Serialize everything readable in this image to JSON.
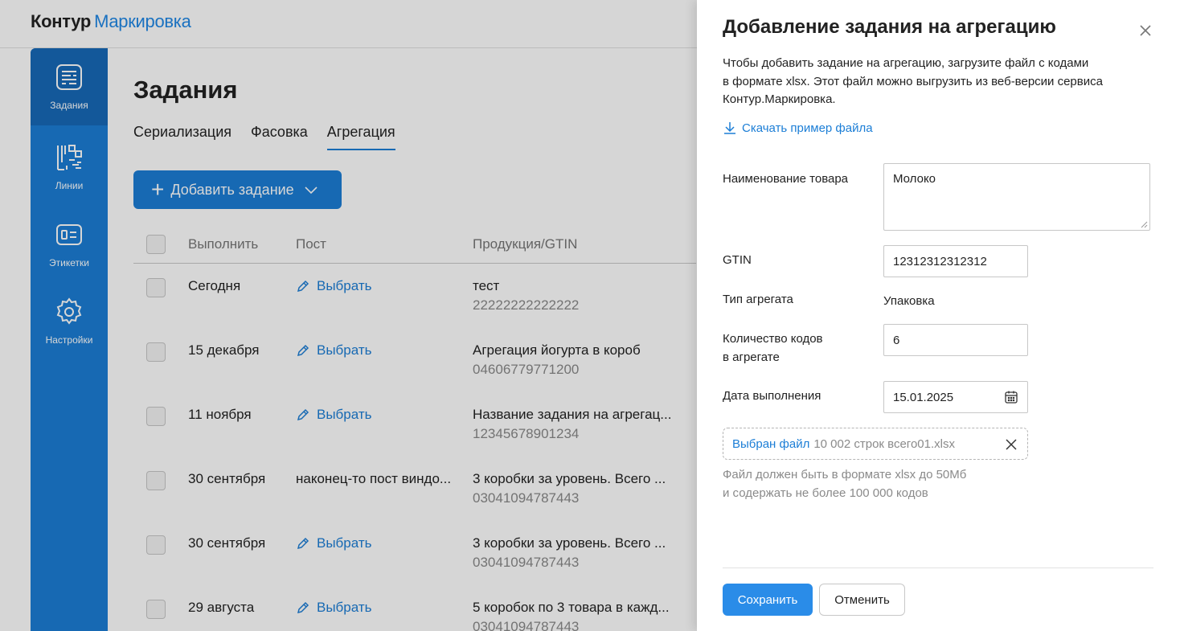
{
  "header": {
    "brand": "Контур",
    "product": "Маркировка"
  },
  "sidebar": {
    "items": [
      {
        "label": "Задания",
        "icon": "tasks-icon",
        "active": true
      },
      {
        "label": "Линии",
        "icon": "lines-icon"
      },
      {
        "label": "Этикетки",
        "icon": "labels-icon"
      },
      {
        "label": "Настройки",
        "icon": "gear-icon"
      }
    ]
  },
  "main": {
    "title": "Задания",
    "tabs": [
      {
        "label": "Сериализация"
      },
      {
        "label": "Фасовка"
      },
      {
        "label": "Агрегация",
        "active": true
      }
    ],
    "add_button": "Добавить задание",
    "table": {
      "columns": [
        "Выполнить",
        "Пост",
        "Продукция/GTIN"
      ],
      "rows": [
        {
          "date": "Сегодня",
          "post": "Выбрать",
          "post_is_link": true,
          "product": "тест",
          "gtin": "22222222222222"
        },
        {
          "date": "15 декабря",
          "post": "Выбрать",
          "post_is_link": true,
          "product": "Агрегация йогурта в короб",
          "gtin": "04606779771200"
        },
        {
          "date": "11 ноября",
          "post": "Выбрать",
          "post_is_link": true,
          "product": "Название задания на агрегац...",
          "gtin": "12345678901234"
        },
        {
          "date": "30 сентября",
          "post": "наконец-то пост виндо...",
          "post_is_link": false,
          "product": "3 коробки за уровень. Всего ...",
          "gtin": "03041094787443"
        },
        {
          "date": "30 сентября",
          "post": "Выбрать",
          "post_is_link": true,
          "product": "3 коробки за уровень. Всего ...",
          "gtin": "03041094787443"
        },
        {
          "date": "29 августа",
          "post": "Выбрать",
          "post_is_link": true,
          "product": "5 коробок по 3 товара в кажд...",
          "gtin": "03041094787443"
        }
      ]
    }
  },
  "panel": {
    "title": "Добавление задания на агрегацию",
    "description_lines": [
      "Чтобы добавить задание на агрегацию, загрузите файл с кодами",
      "в формате xlsx. Этот файл можно выгрузить из веб-версии сервиса",
      "Контур.Маркировка."
    ],
    "download_link": "Скачать пример файла",
    "fields": {
      "product_name_label": "Наименование товара",
      "product_name_value": "Молоко",
      "gtin_label": "GTIN",
      "gtin_value": "12312312312312",
      "aggregate_type_label": "Тип агрегата",
      "aggregate_type_value": "Упаковка",
      "codes_count_label_line1": "Количество кодов",
      "codes_count_label_line2": "в агрегате",
      "codes_count_value": "6",
      "date_label": "Дата выполнения",
      "date_value": "15.01.2025"
    },
    "file": {
      "chosen_label": "Выбран файл",
      "name": "10 002 строк всего01.xlsx"
    },
    "hint_lines": [
      "Файл должен быть в формате xlsx до 50Мб",
      "и содержать не более 100 000 кодов"
    ],
    "save_button": "Сохранить",
    "cancel_button": "Отменить"
  },
  "colors": {
    "accent": "#1c7ed6",
    "save": "#2a8ce8",
    "overlay": "rgba(0,0,0,0.16)"
  }
}
